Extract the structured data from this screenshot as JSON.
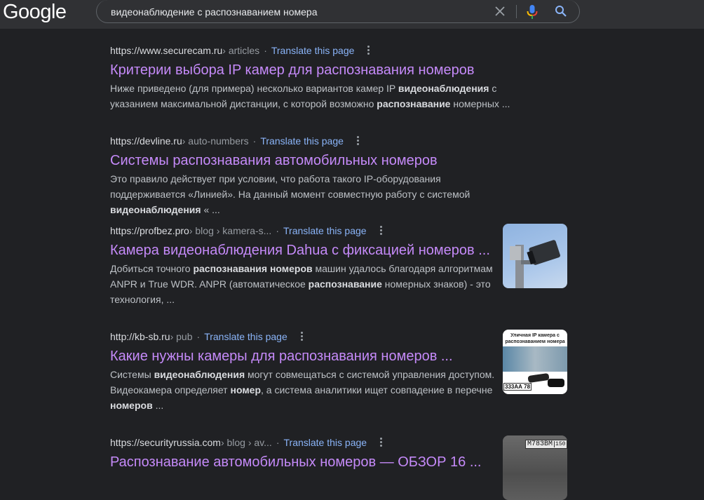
{
  "header": {
    "logo": "Google",
    "search": {
      "value": "видеонаблюдение с распознаванием номера",
      "clear_icon": "close-icon",
      "voice_icon": "microphone-icon",
      "submit_icon": "search-icon"
    }
  },
  "colors": {
    "background": "#202124",
    "header": "#303134",
    "title": "#c58af9",
    "link": "#8ab4f8",
    "text": "#bdc1c6"
  },
  "results": [
    {
      "domain": "https://www.securecam.ru",
      "path": " › articles",
      "translate": "Translate this page",
      "title": "Критерии выбора IP камер для распознавания номеров",
      "snippet": [
        {
          "t": "Ниже приведено (для примера) несколько вариантов камер IP ",
          "b": false
        },
        {
          "t": "видеонаблюдения",
          "b": true
        },
        {
          "t": " с указанием максимальной дистанции, с которой возможно ",
          "b": false
        },
        {
          "t": "распознавание",
          "b": true
        },
        {
          "t": " номерных ...",
          "b": false
        }
      ]
    },
    {
      "domain": "https://devline.ru",
      "path": " › auto-numbers",
      "translate": "Translate this page",
      "title": "Системы распознавания автомобильных номеров",
      "snippet": [
        {
          "t": "Это правило действует при условии, что работа такого IP-оборудования поддерживается «Линией». На данный момент совместную работу с системой ",
          "b": false
        },
        {
          "t": "видеонаблюдения",
          "b": true
        },
        {
          "t": " « ...",
          "b": false
        }
      ]
    },
    {
      "domain": "https://profbez.pro",
      "path": " › blog › kamera-s...",
      "translate": "Translate this page",
      "title": "Камера видеонаблюдения Dahua с фиксацией номеров ...",
      "snippet": [
        {
          "t": "Добиться точного ",
          "b": false
        },
        {
          "t": "распознавания номеров",
          "b": true
        },
        {
          "t": " машин удалось благодаря алгоритмам ANPR и True WDR. ANPR (автоматическое ",
          "b": false
        },
        {
          "t": "распознавание",
          "b": true
        },
        {
          "t": " номерных знаков) - это технология, ...",
          "b": false
        }
      ],
      "thumbnail": "camera-photo"
    },
    {
      "domain": "http://kb-sb.ru",
      "path": " › pub",
      "translate": "Translate this page",
      "title": "Какие нужны камеры для распознавания номеров ...",
      "snippet": [
        {
          "t": "Системы ",
          "b": false
        },
        {
          "t": "видеонаблюдения",
          "b": true
        },
        {
          "t": " могут совмещаться с системой управления доступом. Видеокамера определяет ",
          "b": false
        },
        {
          "t": "номер",
          "b": true
        },
        {
          "t": ", а система аналитики ищет совпадение в перечне ",
          "b": false
        },
        {
          "t": "номеров",
          "b": true
        },
        {
          "t": " ...",
          "b": false
        }
      ],
      "thumbnail": "camera-banner",
      "thumbnail_text": [
        "Уличная IP камера с",
        "распознаванием номера"
      ],
      "thumbnail_plate": "333АА",
      "thumbnail_region": "78"
    },
    {
      "domain": "https://securityrussia.com",
      "path": " › blog › av...",
      "translate": "Translate this page",
      "title": "Распознавание автомобильных номеров — ОБЗОР 16 ...",
      "snippet": [],
      "thumbnail": "license-plate-photo",
      "thumbnail_plate": "М783ВМ",
      "thumbnail_region": "150"
    }
  ]
}
